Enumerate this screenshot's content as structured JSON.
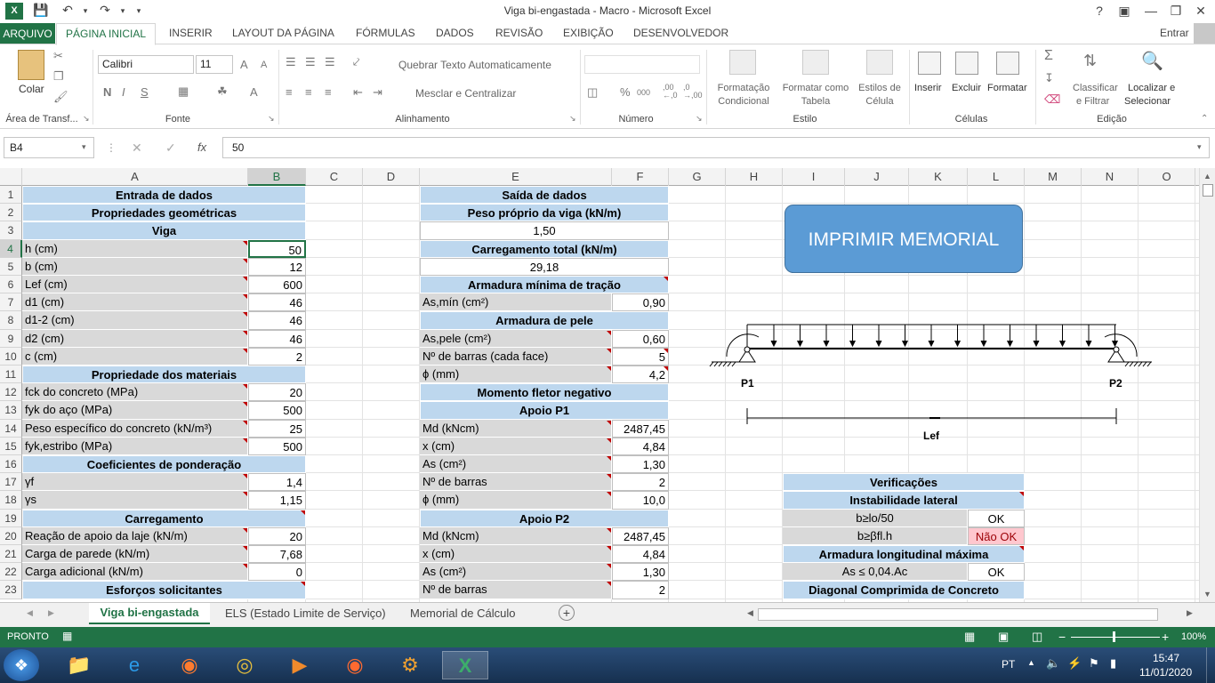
{
  "window": {
    "title": "Viga bi-engastada - Macro - Microsoft Excel",
    "help": "?",
    "user": "Entrar"
  },
  "ribbon_tabs": [
    "ARQUIVO",
    "PÁGINA INICIAL",
    "INSERIR",
    "LAYOUT DA PÁGINA",
    "FÓRMULAS",
    "DADOS",
    "REVISÃO",
    "EXIBIÇÃO",
    "DESENVOLVEDOR"
  ],
  "ribbon": {
    "paste": "Colar",
    "font_name": "Calibri",
    "font_size": "11",
    "bold": "N",
    "italic": "I",
    "underline": "S",
    "grow_font": "A",
    "shrink_font": "A",
    "font_color": "A",
    "wrap_text": "Quebrar Texto Automaticamente",
    "merge_center": "Mesclar e Centralizar",
    "percent": "%",
    "thousands": "000",
    "dec_inc": ",00\n,0",
    "dec_dec": ",0\n,00",
    "cond_format_1": "Formatação",
    "cond_format_2": "Condicional",
    "format_table_1": "Formatar como",
    "format_table_2": "Tabela",
    "cell_styles_1": "Estilos de",
    "cell_styles_2": "Célula",
    "insert": "Inserir",
    "delete": "Excluir",
    "format": "Formatar",
    "sort_1": "Classificar",
    "sort_2": "e Filtrar",
    "find_1": "Localizar e",
    "find_2": "Selecionar",
    "groups": {
      "clipboard": "Área de Transf...",
      "font": "Fonte",
      "alignment": "Alinhamento",
      "number": "Número",
      "style": "Estilo",
      "cells": "Células",
      "editing": "Edição"
    }
  },
  "formula_bar": {
    "name_box": "B4",
    "fx": "fx",
    "value": "50"
  },
  "columns": [
    "A",
    "B",
    "C",
    "D",
    "E",
    "F",
    "G",
    "H",
    "I",
    "J",
    "K",
    "L",
    "M",
    "N",
    "O"
  ],
  "rows": [
    "1",
    "2",
    "3",
    "4",
    "5",
    "6",
    "7",
    "8",
    "9",
    "10",
    "11",
    "12",
    "13",
    "14",
    "15",
    "16",
    "17",
    "18",
    "19",
    "20",
    "21",
    "22",
    "23"
  ],
  "left_table": {
    "title": "Entrada de dados",
    "geo_header": "Propriedades geométricas",
    "viga_header": "Viga",
    "geo": [
      {
        "label": "h (cm)",
        "value": "50"
      },
      {
        "label": "b (cm)",
        "value": "12"
      },
      {
        "label": "Lef (cm)",
        "value": "600"
      },
      {
        "label": "d1 (cm)",
        "value": "46"
      },
      {
        "label": "d1-2 (cm)",
        "value": "46"
      },
      {
        "label": "d2 (cm)",
        "value": "46"
      },
      {
        "label": "c (cm)",
        "value": "2"
      }
    ],
    "mat_header": "Propriedade dos materiais",
    "mat": [
      {
        "label": "fck do concreto (MPa)",
        "value": "20"
      },
      {
        "label": "fyk do aço (MPa)",
        "value": "500"
      },
      {
        "label": "Peso específico do concreto (kN/m³)",
        "value": "25"
      },
      {
        "label": "fyk,estribo (MPa)",
        "value": "500"
      }
    ],
    "coef_header": "Coeficientes de ponderação",
    "coef": [
      {
        "label": "γf",
        "value": "1,4"
      },
      {
        "label": "γs",
        "value": "1,15"
      }
    ],
    "load_header": "Carregamento",
    "loads": [
      {
        "label": "Reação de apoio da laje (kN/m)",
        "value": "20"
      },
      {
        "label": "Carga de parede (kN/m)",
        "value": "7,68"
      },
      {
        "label": "Carga adicional (kN/m)",
        "value": "0"
      }
    ],
    "esf_header": "Esforços solicitantes"
  },
  "right_table": {
    "title": "Saída de dados",
    "peso_header": "Peso próprio da viga (kN/m)",
    "peso_value": "1,50",
    "carr_header": "Carregamento total (kN/m)",
    "carr_value": "29,18",
    "asmin_header": "Armadura mínima de tração",
    "asmin": {
      "label": "As,mín (cm²)",
      "value": "0,90"
    },
    "pele_header": "Armadura de pele",
    "pele": [
      {
        "label": "As,pele (cm²)",
        "value": "0,60"
      },
      {
        "label": "Nº de barras (cada face)",
        "value": "5"
      },
      {
        "label": "ϕ (mm)",
        "value": "4,2"
      }
    ],
    "mneg_header": "Momento fletor negativo",
    "p1_header": "Apoio P1",
    "p1": [
      {
        "label": "Md (kNcm)",
        "value": "2487,45"
      },
      {
        "label": "x (cm)",
        "value": "4,84"
      },
      {
        "label": "As (cm²)",
        "value": "1,30"
      },
      {
        "label": "Nº de barras",
        "value": "2"
      },
      {
        "label": "ϕ (mm)",
        "value": "10,0"
      }
    ],
    "p2_header": "Apoio P2",
    "p2": [
      {
        "label": "Md (kNcm)",
        "value": "2487,45"
      },
      {
        "label": "x (cm)",
        "value": "4,84"
      },
      {
        "label": "As (cm²)",
        "value": "1,30"
      },
      {
        "label": "Nº de barras",
        "value": "2"
      }
    ]
  },
  "button": {
    "label": "IMPRIMIR MEMORIAL"
  },
  "diagram": {
    "p1": "P1",
    "p2": "P2",
    "lef": "Lef"
  },
  "verif": {
    "title": "Verificações",
    "inst_header": "Instabilidade lateral",
    "rows": [
      {
        "label": "b≥lo/50",
        "status": "OK"
      },
      {
        "label": "b≥βfl.h",
        "status": "Não OK"
      }
    ],
    "arm_header": "Armadura longitudinal máxima",
    "arm_row": {
      "label": "As ≤ 0,04.Ac",
      "status": "OK"
    },
    "diag_header": "Diagonal Comprimida de Concreto"
  },
  "sheet_tabs": [
    "Viga bi-engastada",
    "ELS (Estado Limite de Serviço)",
    "Memorial de Cálculo"
  ],
  "status": {
    "ready": "PRONTO",
    "zoom": "100%"
  },
  "taskbar": {
    "lang": "PT",
    "time": "15:47",
    "date": "11/01/2020"
  },
  "colors": {
    "excel_green": "#217346",
    "header_blue": "#bdd7ee",
    "label_gray": "#d9d9d9",
    "button_blue": "#5b9bd5",
    "fail_red": "#ffc7ce"
  }
}
